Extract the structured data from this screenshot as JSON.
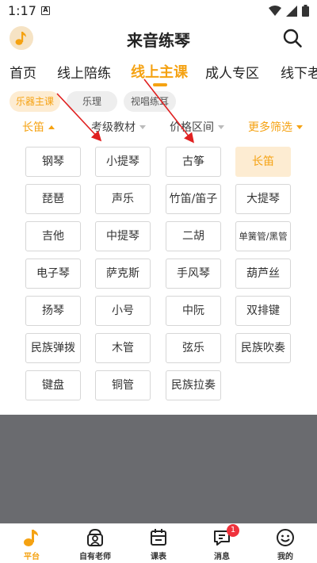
{
  "status_bar": {
    "time": "1:17",
    "a_icon": "A"
  },
  "header": {
    "title": "来音练琴",
    "logo_icon": "music-note-icon",
    "search_icon": "search-icon"
  },
  "main_tabs": [
    {
      "label": "首页"
    },
    {
      "label": "线上陪练"
    },
    {
      "label": "线上主课",
      "active": true
    },
    {
      "label": "成人专区"
    },
    {
      "label": "线下老"
    }
  ],
  "sub_tabs": [
    {
      "label": "乐器主课",
      "active": true
    },
    {
      "label": "乐理"
    },
    {
      "label": "视唱练耳"
    }
  ],
  "filters": [
    {
      "label": "长笛",
      "active": true
    },
    {
      "label": "考级教材"
    },
    {
      "label": "价格区间"
    },
    {
      "label": "更多筛选"
    }
  ],
  "instruments": [
    {
      "label": "钢琴"
    },
    {
      "label": "小提琴"
    },
    {
      "label": "古筝"
    },
    {
      "label": "长笛",
      "selected": true
    },
    {
      "label": "琵琶"
    },
    {
      "label": "声乐"
    },
    {
      "label": "竹笛/笛子"
    },
    {
      "label": "大提琴"
    },
    {
      "label": "吉他"
    },
    {
      "label": "中提琴"
    },
    {
      "label": "二胡"
    },
    {
      "label": "单簧管/黑管"
    },
    {
      "label": "电子琴"
    },
    {
      "label": "萨克斯"
    },
    {
      "label": "手风琴"
    },
    {
      "label": "葫芦丝"
    },
    {
      "label": "扬琴"
    },
    {
      "label": "小号"
    },
    {
      "label": "中阮"
    },
    {
      "label": "双排键"
    },
    {
      "label": "民族弹拨"
    },
    {
      "label": "木管"
    },
    {
      "label": "弦乐"
    },
    {
      "label": "民族吹奏"
    },
    {
      "label": "键盘"
    },
    {
      "label": "铜管"
    },
    {
      "label": "民族拉奏"
    }
  ],
  "bottom_nav": [
    {
      "label": "平台",
      "icon": "music-note-icon",
      "active": true
    },
    {
      "label": "自有老师",
      "icon": "teacher-icon"
    },
    {
      "label": "课表",
      "icon": "calendar-icon"
    },
    {
      "label": "消息",
      "icon": "message-icon",
      "badge": "1"
    },
    {
      "label": "我的",
      "icon": "smiley-icon"
    }
  ],
  "colors": {
    "accent": "#f5a212",
    "accent_bg": "#fdecd2",
    "overlay": "#6a6b6f",
    "badge": "#f0323c",
    "arrow": "#e02020"
  }
}
